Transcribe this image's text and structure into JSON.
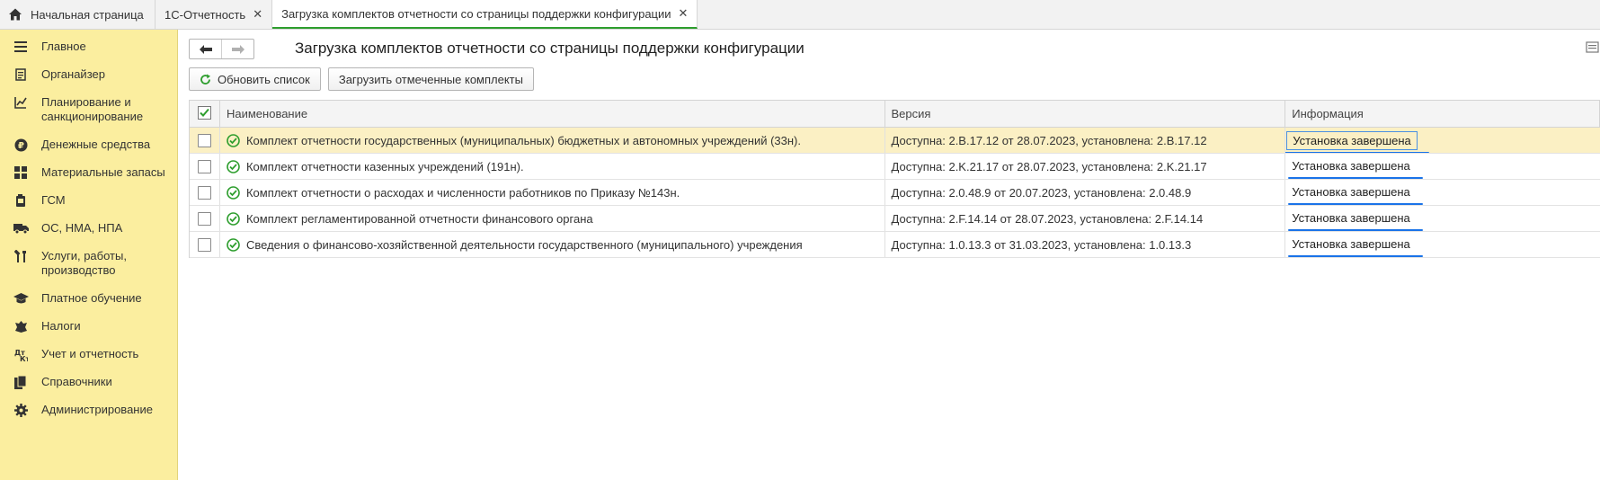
{
  "tabs": [
    {
      "label": "Начальная страница",
      "icon": "home-icon"
    },
    {
      "label": "1С-Отчетность",
      "closable": true
    },
    {
      "label": "Загрузка комплектов отчетности со страницы поддержки конфигурации",
      "closable": true,
      "active": true
    }
  ],
  "sidebar": {
    "items": [
      {
        "label": "Главное",
        "icon": "menu-icon"
      },
      {
        "label": "Органайзер",
        "icon": "organizer-icon"
      },
      {
        "label": "Планирование и санкционирование",
        "icon": "planning-icon"
      },
      {
        "label": "Денежные средства",
        "icon": "money-icon"
      },
      {
        "label": "Материальные запасы",
        "icon": "inventory-icon"
      },
      {
        "label": "ГСМ",
        "icon": "fuel-icon"
      },
      {
        "label": "ОС, НМА, НПА",
        "icon": "truck-icon"
      },
      {
        "label": "Услуги, работы, производство",
        "icon": "tools-icon"
      },
      {
        "label": "Платное обучение",
        "icon": "graduation-icon"
      },
      {
        "label": "Налоги",
        "icon": "emblem-icon"
      },
      {
        "label": "Учет и отчетность",
        "icon": "accounting-icon"
      },
      {
        "label": "Справочники",
        "icon": "books-icon"
      },
      {
        "label": "Администрирование",
        "icon": "gear-icon"
      }
    ]
  },
  "header": {
    "title": "Загрузка комплектов отчетности со страницы поддержки конфигурации",
    "back_icon": "arrow-left-icon",
    "forward_icon": "arrow-right-icon"
  },
  "toolbar": {
    "refresh_label": "Обновить список",
    "load_label": "Загрузить отмеченные комплекты"
  },
  "table": {
    "columns": [
      "Наименование",
      "Версия",
      "Информация"
    ],
    "rows": [
      {
        "name": "Комплект отчетности государственных (муниципальных) бюджетных и автономных учреждений (33н).",
        "version": "Доступна: 2.B.17.12 от 28.07.2023, установлена: 2.B.17.12",
        "info": "Установка завершена",
        "checked": false
      },
      {
        "name": "Комплект отчетности казенных учреждений (191н).",
        "version": "Доступна: 2.K.21.17 от 28.07.2023, установлена: 2.K.21.17",
        "info": "Установка завершена",
        "checked": false
      },
      {
        "name": "Комплект отчетности о расходах и численности работников по Приказу №143н.",
        "version": "Доступна: 2.0.48.9 от 20.07.2023, установлена: 2.0.48.9",
        "info": "Установка завершена",
        "checked": false
      },
      {
        "name": "Комплект регламентированной отчетности финансового органа",
        "version": "Доступна: 2.F.14.14 от 28.07.2023, установлена: 2.F.14.14",
        "info": "Установка завершена",
        "checked": false
      },
      {
        "name": "Сведения о финансово-хозяйственной деятельности государственного (муниципального) учреждения",
        "version": "Доступна: 1.0.13.3 от 31.03.2023, установлена: 1.0.13.3",
        "info": "Установка завершена",
        "checked": false
      }
    ]
  },
  "colors": {
    "sidebar_bg": "#fbee9f",
    "selected_row_bg": "#fbf0c4",
    "active_tab_underline": "#2e9e2e",
    "status_ok": "#2e9e2e",
    "link_underline": "#1a73e8"
  }
}
